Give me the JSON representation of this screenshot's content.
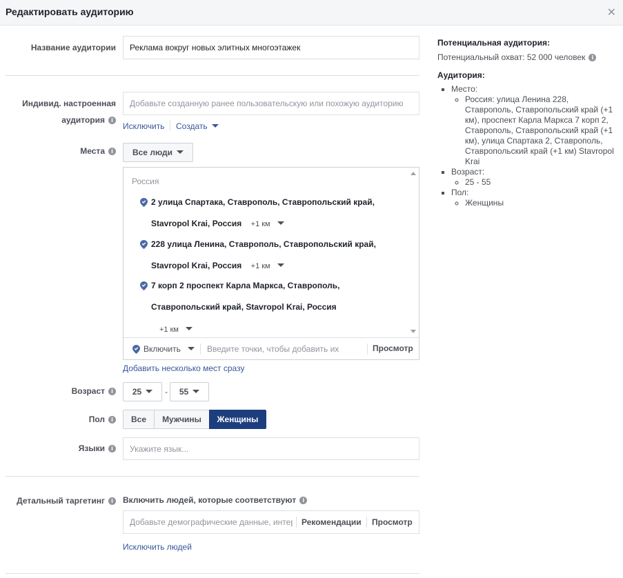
{
  "dialog": {
    "title": "Редактировать аудиторию"
  },
  "name_row": {
    "label": "Название аудитории",
    "value": "Реклама вокруг новых элитных многоэтажек"
  },
  "custom_audience": {
    "label_line1": "Индивид. настроенная",
    "label_line2": "аудитория",
    "placeholder": "Добавьте созданную ранее пользовательскую или похожую аудиторию",
    "exclude_link": "Исключить",
    "create_link": "Создать"
  },
  "places": {
    "label": "Места",
    "dropdown": "Все люди",
    "country": "Россия",
    "locations": [
      {
        "line1": "2 улица Спартака, Ставрополь, Ставропольский край,",
        "line2": "Stavropol Krai, Россия",
        "radius": "+1 км"
      },
      {
        "line1": "228 улица Ленина, Ставрополь, Ставропольский край,",
        "line2": "Stavropol Krai, Россия",
        "radius": "+1 км"
      },
      {
        "line1": "7 корп 2 проспект Карла Маркса, Ставрополь,",
        "line2": "Ставропольский край, Stavropol Krai, Россия",
        "radius": "+1 км"
      }
    ],
    "include": "Включить",
    "input_placeholder": "Введите точки, чтобы добавить их",
    "browse": "Просмотр",
    "bulk_link": "Добавить несколько мест сразу"
  },
  "age": {
    "label": "Возраст",
    "min": "25",
    "dash": "-",
    "max": "55"
  },
  "gender": {
    "label": "Пол",
    "options": [
      "Все",
      "Мужчины",
      "Женщины"
    ],
    "selected": "Женщины"
  },
  "languages": {
    "label": "Языки",
    "placeholder": "Укажите язык..."
  },
  "detailed": {
    "label": "Детальный таргетинг",
    "include_text": "Включить людей, которые соответствуют",
    "placeholder": "Добавьте демографические данные, интересы",
    "recommendations": "Рекомендации",
    "browse": "Просмотр",
    "exclude_link": "Исключить людей"
  },
  "summary": {
    "potential_title": "Потенциальная аудитория:",
    "potential_reach": "Потенциальный охват: 52 000 человек",
    "audience_title": "Аудитория:",
    "place_label": "Место:",
    "place_value": "Россия: улица Ленина 228, Ставрополь, Ставропольский край (+1 км), проспект Карла Маркса 7 корп 2, Ставрополь, Ставропольский край (+1 км), улица Спартака 2, Ставрополь, Ставропольский край (+1 км) Stavropol Krai",
    "age_label": "Возраст:",
    "age_value": "25 - 55",
    "gender_label": "Пол:",
    "gender_value": "Женщины"
  },
  "colors": {
    "accent": "#1d3e7e",
    "link": "#365899",
    "pin": "#4a6aa5"
  }
}
